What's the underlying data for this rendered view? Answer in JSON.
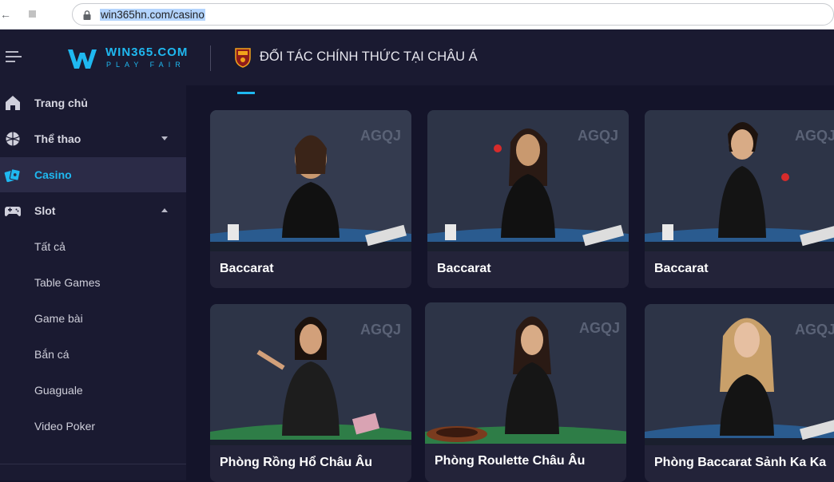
{
  "browser": {
    "url": "win365hn.com/casino"
  },
  "header": {
    "logo_name": "WIN365.COM",
    "logo_sub": "PLAY FAIR",
    "partner_text": "ĐỐI TÁC CHÍNH THỨC TẠI CHÂU Á"
  },
  "sidebar": {
    "items": [
      {
        "label": "Trang chủ",
        "icon": "home-icon"
      },
      {
        "label": "Thể thao",
        "icon": "ball-icon"
      },
      {
        "label": "Casino",
        "icon": "cards-icon"
      },
      {
        "label": "Slot",
        "icon": "gamepad-icon"
      },
      {
        "label": "Tất cả"
      },
      {
        "label": "Table Games"
      },
      {
        "label": "Game bài"
      },
      {
        "label": "Bắn cá"
      },
      {
        "label": "Guaguale"
      },
      {
        "label": "Video Poker"
      }
    ]
  },
  "games": [
    {
      "title": "Baccarat",
      "provider": "AGQJ"
    },
    {
      "title": "Baccarat",
      "provider": "AGQJ"
    },
    {
      "title": "Baccarat",
      "provider": "AGQJ"
    },
    {
      "title": "Phòng Rồng Hổ Châu Âu",
      "provider": "AGQJ"
    },
    {
      "title": "Phòng Roulette Châu Âu",
      "provider": "AGQJ"
    },
    {
      "title": "Phòng Baccarat Sảnh Ka Ka",
      "provider": "AGQJ"
    }
  ],
  "colors": {
    "accent": "#1fb8f0",
    "sidebar_bg": "#1a1a31",
    "active_bg": "#2b2b47",
    "card_bg": "#232339"
  }
}
